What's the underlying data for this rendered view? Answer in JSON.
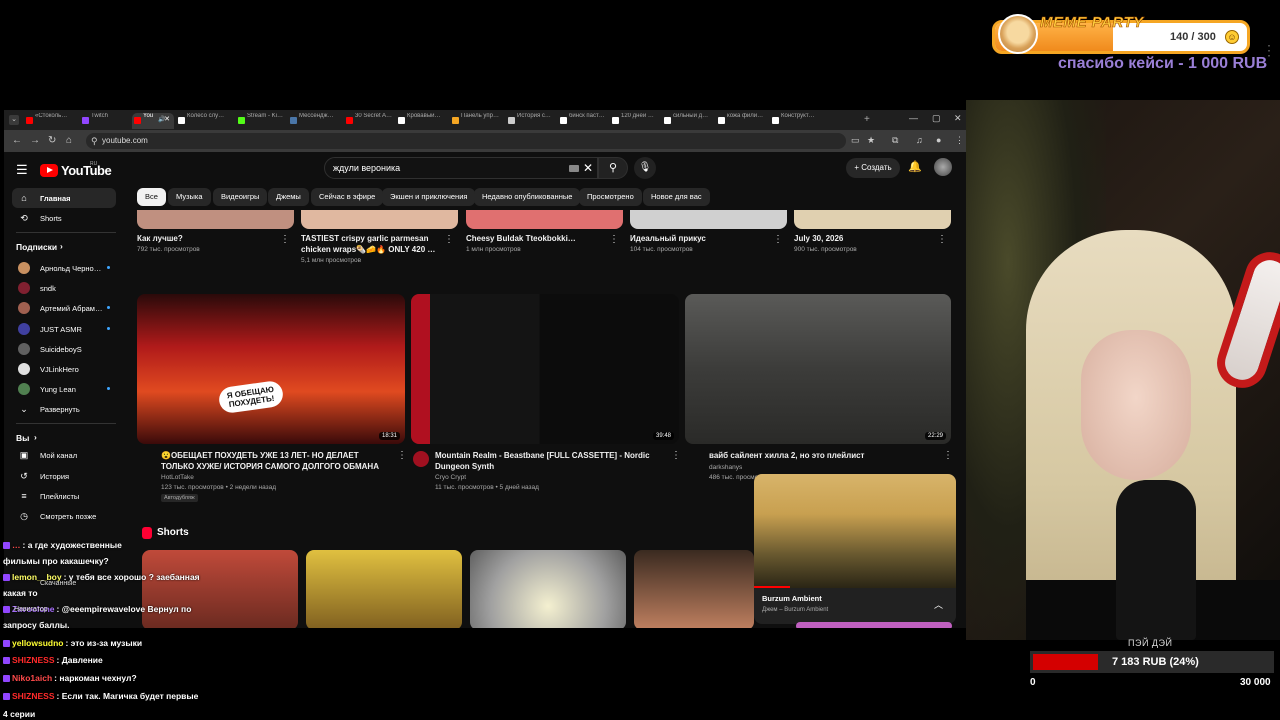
{
  "overlay": {
    "meme_party": {
      "title": "MEME PARTY",
      "count": "140 / 300",
      "progress": 0.4667,
      "thanks": "спасибо кейси - 1 000 RUB"
    }
  },
  "browser": {
    "tabs": [
      {
        "label": "«Стоколь…",
        "color": "#ff0000"
      },
      {
        "label": "Twitch",
        "color": "#9146ff"
      },
      {
        "label": "You",
        "color": "#ff0000",
        "active": true
      },
      {
        "label": "Колесо слу…",
        "color": "#ffffff"
      },
      {
        "label": "Stream - Ki…",
        "color": "#53fc18"
      },
      {
        "label": "Мессендж…",
        "color": "#4a76a8"
      },
      {
        "label": "30 Secret A…",
        "color": "#ff0000"
      },
      {
        "label": "Кровавый…",
        "color": "#ffffff"
      },
      {
        "label": "Панель упр…",
        "color": "#f5a623"
      },
      {
        "label": "История с…",
        "color": "#cccccc"
      },
      {
        "label": "бинск паст…",
        "color": "#ffffff"
      },
      {
        "label": "120 дней …",
        "color": "#ffffff"
      },
      {
        "label": "сильный д…",
        "color": "#ffffff"
      },
      {
        "label": "кожа фили…",
        "color": "#ffffff"
      },
      {
        "label": "Конструкт…",
        "color": "#ffffff"
      }
    ],
    "url": "youtube.com"
  },
  "youtube": {
    "logo": "YouTube",
    "logo_region": "RU",
    "search": {
      "value": "ждули вероника"
    },
    "create_label": "Создать",
    "sidebar": {
      "main": [
        {
          "label": "Главная",
          "icon": "home-icon",
          "glyph": "⌂"
        },
        {
          "label": "Shorts",
          "icon": "shorts-icon",
          "glyph": "⟲"
        }
      ],
      "subs_heading": "Подписки",
      "subs": [
        {
          "label": "Арнольд Черно…",
          "color": "#c89060",
          "dot": true
        },
        {
          "label": "sndk",
          "color": "#802030",
          "dot": false
        },
        {
          "label": "Артемий Абрам…",
          "color": "#a06050",
          "dot": true
        },
        {
          "label": "JUST ASMR",
          "color": "#4040a0",
          "dot": true
        },
        {
          "label": "SuicideboyS",
          "color": "#606060",
          "dot": false
        },
        {
          "label": "VJLinkHero",
          "color": "#e0e0e0",
          "dot": false
        },
        {
          "label": "Yung Lean",
          "color": "#508050",
          "dot": true
        }
      ],
      "expand_label": "Развернуть",
      "you_heading": "Вы",
      "you": [
        {
          "label": "Мой канал",
          "icon": "channel-icon",
          "glyph": "▣"
        },
        {
          "label": "История",
          "icon": "history-icon",
          "glyph": "↺"
        },
        {
          "label": "Плейлисты",
          "icon": "playlists-icon",
          "glyph": "≡"
        },
        {
          "label": "Смотреть позже",
          "icon": "watch-later-icon",
          "glyph": "◷"
        }
      ]
    },
    "chips": [
      "Все",
      "Музыка",
      "Видеоигры",
      "Джемы",
      "Сейчас в эфире",
      "Экшен и приключения",
      "Недавно опубликованные",
      "Просмотрено",
      "Новое для вас"
    ],
    "row1": [
      {
        "title": "Как лучше?",
        "meta1": "792 тыс. просмотров",
        "meta2": "",
        "color": "#c09080"
      },
      {
        "title": "TASTIEST crispy garlic parmesan chicken wraps🌯🧀🔥 ONLY 420 …",
        "meta1": "5,1 млн просмотров",
        "meta2": "",
        "color": "#e0b8a0"
      },
      {
        "title": "Cheesy Buldak Tteokbokki…",
        "meta1": "1 млн просмотров",
        "meta2": "",
        "color": "#e07070"
      },
      {
        "title": "Идеальный прикус",
        "meta1": "104 тыс. просмотров",
        "meta2": "",
        "color": "#d0d0d0"
      },
      {
        "title": "July 30, 2026",
        "meta1": "900 тыс. просмотров",
        "meta2": "",
        "color": "#e0d0b0"
      }
    ],
    "row2": [
      {
        "title": "😮ОБЕЩАЕТ ПОХУДЕТЬ УЖЕ 13 ЛЕТ- НО ДЕЛАЕТ ТОЛЬКО ХУЖЕ/ ИСТОРИЯ САМОГО ДОЛГОГО ОБМАНА [Amberlynn …",
        "channel": "HotLotTake",
        "meta": "123 тыс. просмотров • 2 недели назад",
        "duration": "18:31",
        "badge": "Автодубляж",
        "thumb_text": "Я ОБЕЩАЮ ПОХУДЕТЬ!"
      },
      {
        "title": "Mountain Realm - Beastbane [FULL CASSETTE] - Nordic Dungeon Synth",
        "channel": "Cryo Crypt",
        "meta": "11 тыс. просмотров • 5 дней назад",
        "duration": "39:48"
      },
      {
        "title": "вайб сайлент хилла 2, но это плейлист",
        "channel": "darkshanys",
        "meta": "486 тыс. просмотров",
        "duration": "22:29"
      }
    ],
    "shorts_heading": "Shorts",
    "mini_player": {
      "title": "Burzum Ambient",
      "subtitle": "Джем – Burzum Ambient"
    }
  },
  "chat": [
    {
      "nick": "…",
      "text": ": а где художественные",
      "color": "#ff4a4a"
    },
    {
      "nick": "",
      "text": "фильмы про какашечку?",
      "color": "#ffffff"
    },
    {
      "nick": "lemon__boy",
      "text": ": у тебя все хорошо ? заебанная",
      "color": "#ffff66"
    },
    {
      "nick": "",
      "text": "какая то",
      "color": "#ffffff"
    },
    {
      "nick": "Zavoolone",
      "text": ": @eeempirewavelove Вернул по",
      "color": "#a970ff"
    },
    {
      "nick": "",
      "text": "запросу баллы.",
      "color": "#ffffff"
    },
    {
      "nick": "yellowsudno",
      "text": ": это из-за музыки",
      "color": "#ffff33"
    },
    {
      "nick": "SHIZNESS",
      "text": ": Давление",
      "color": "#ff2a2a"
    },
    {
      "nick": "Niko1aich",
      "text": ": наркоман чехнул?",
      "color": "#ff4a4a"
    },
    {
      "nick": "SHIZNESS",
      "text": ": Если так. Магичка будет первые",
      "color": "#ff2a2a"
    },
    {
      "nick": "",
      "text": "4 серии",
      "color": "#ffffff"
    }
  ],
  "chat_sidebar_ghost": {
    "subscriptions": "Подписчикам",
    "navigator": "Навигатор",
    "downloads": "Скачанные"
  },
  "donation": {
    "name": "ПЭЙ ДЭЙ",
    "text": "7 183 RUB (24%)",
    "progress": 0.24,
    "min": "0",
    "max": "30 000"
  }
}
